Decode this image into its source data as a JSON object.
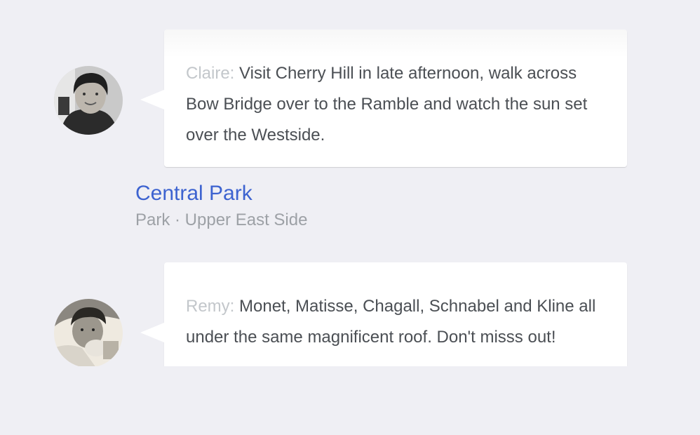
{
  "tips": [
    {
      "author": "Claire:",
      "text": "Visit Cherry Hill in late afternoon, walk across Bow Bridge over to the Ramble and watch the sun set over the Westside."
    },
    {
      "author": "Remy:",
      "text": "Monet, Matisse, Chagall, Schnabel and Kline all under the same magnificent roof. Don't misss out!"
    }
  ],
  "venue": {
    "name": "Central Park",
    "meta": "Park · Upper East Side"
  },
  "colors": {
    "background": "#efeff4",
    "link": "#3d63d0",
    "author": "#c3c7cb",
    "body_text": "#4b4f54",
    "meta_text": "#9da1a6"
  }
}
